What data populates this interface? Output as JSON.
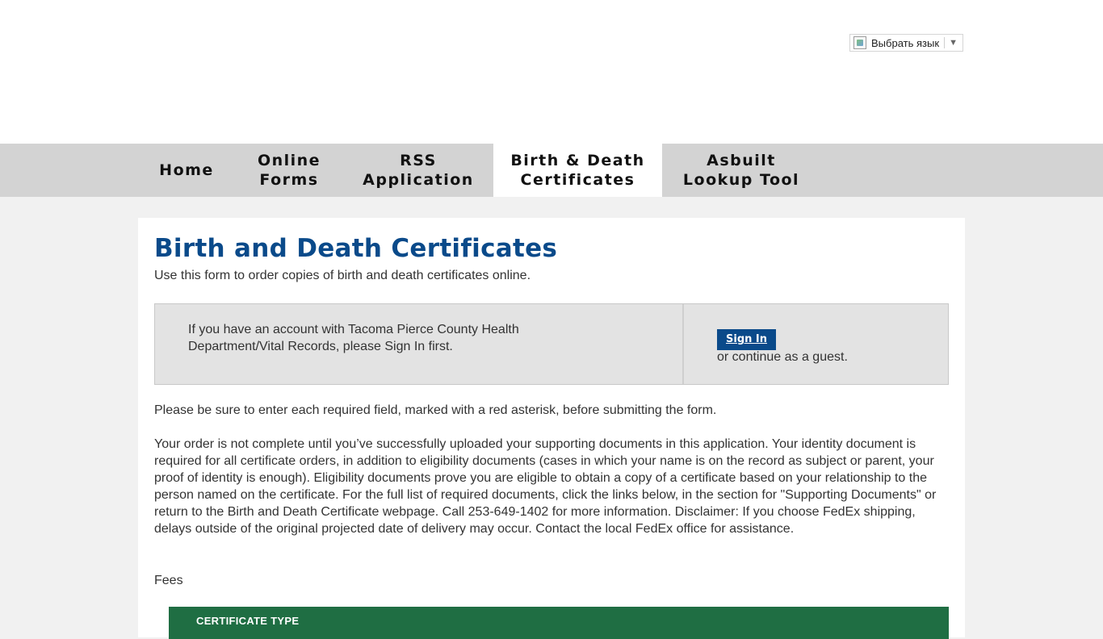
{
  "translate": {
    "label": "Выбрать язык",
    "arrow": "▼"
  },
  "nav": {
    "items": [
      {
        "label": "Home"
      },
      {
        "label": "Online\nForms"
      },
      {
        "label": "RSS\nApplication"
      },
      {
        "label": "Birth & Death\nCertificates",
        "active": true
      },
      {
        "label": "Asbuilt\nLookup Tool"
      }
    ]
  },
  "page": {
    "title": "Birth and Death Certificates",
    "subtitle": "Use this form to order copies of birth and death certificates online."
  },
  "signin": {
    "message": "If you have an account with Tacoma Pierce County Health Department/Vital Records, please Sign In first.",
    "button_label": "Sign In",
    "guest_text": "or continue as a guest."
  },
  "body": {
    "required_note": "Please be sure to enter each required field, marked with a red asterisk, before submitting the form.",
    "order_note": "Your order is not complete until you’ve successfully uploaded your supporting documents in this application. Your identity document is required for all certificate orders, in addition to eligibility documents (cases in which your name is on the record as subject or parent, your proof of identity is enough). Eligibility documents prove you are eligible to obtain a copy of a certificate based on your relationship to the person named on the certificate. For the full list of required documents, click the links below, in the section for \"Supporting Documents\" or return to the Birth and Death Certificate webpage. Call 253-649-1402 for more information. Disclaimer: If you choose FedEx shipping, delays outside of the original projected date of delivery may occur. Contact the local FedEx office for assistance.",
    "fees_label": "Fees"
  },
  "fees_table": {
    "header_col1": "CERTIFICATE TYPE"
  },
  "colors": {
    "title_blue": "#0a4a8a",
    "nav_bg": "#d3d3d3",
    "table_header_green": "#1f6e43"
  }
}
